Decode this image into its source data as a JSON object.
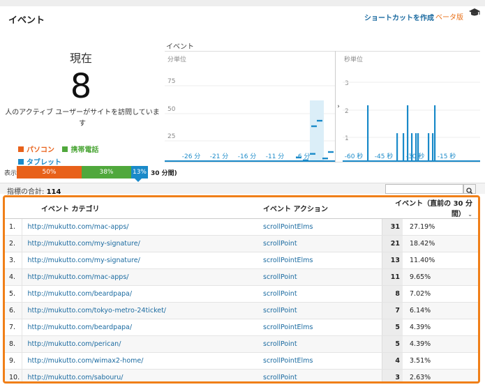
{
  "header": {
    "title": "イベント",
    "shortcut": "ショートカットを作成",
    "beta": "ベータ版"
  },
  "realtime": {
    "now_label": "現在",
    "active_users": "8",
    "description": "人のアクティブ ユーザーがサイトを訪問していま す"
  },
  "devices": {
    "prefix": "表示",
    "suffix": "30 分間)",
    "items": [
      {
        "name": "パソコン",
        "percent": "50%",
        "share": 50,
        "color": "#e8611a"
      },
      {
        "name": "携帯電話",
        "percent": "38%",
        "share": 38,
        "color": "#50a83c"
      },
      {
        "name": "タブレット",
        "percent": "13%",
        "share": 13,
        "color": "#1a8ac9"
      }
    ]
  },
  "charts": {
    "section_title": "イベント",
    "per_minute": {
      "label": "分単位",
      "y_ticks": [
        "75",
        "50",
        "25"
      ],
      "x_ticks": [
        "-26 分",
        "-21 分",
        "-16 分",
        "-11 分",
        "-6 分"
      ]
    },
    "per_second": {
      "label": "秒単位",
      "y_ticks": [
        "3",
        "2",
        "1"
      ],
      "x_ticks": [
        "-60 秒",
        "-45 秒",
        "-30 秒",
        "-15 秒"
      ]
    },
    "toggle": "›"
  },
  "chart_data": [
    {
      "type": "bar",
      "title": "分単位",
      "ylim": [
        0,
        100
      ],
      "x": [
        -7,
        -6,
        -5,
        -4,
        -3,
        -2,
        -1
      ],
      "values": [
        4,
        1,
        8,
        38,
        44,
        3,
        10
      ]
    },
    {
      "type": "bar",
      "title": "秒単位",
      "ylim": [
        0,
        4
      ],
      "x": [
        -49,
        -35,
        -32,
        -30,
        -28,
        -26,
        -25,
        -20,
        -18,
        -17
      ],
      "values": [
        2,
        1,
        1,
        2,
        1,
        1,
        1,
        1,
        1,
        2
      ]
    }
  ],
  "table": {
    "total_label": "指標の合計:",
    "total_value": "114",
    "columns": {
      "category": "イベント カテゴリ",
      "action": "イベント アクション",
      "events": "イベント（直前の 30 分間）"
    },
    "rows": [
      {
        "idx": "1.",
        "category": "http://mukutto.com/mac-apps/",
        "action": "scrollPointElms",
        "count": "31",
        "pct": "27.19%"
      },
      {
        "idx": "2.",
        "category": "http://mukutto.com/my-signature/",
        "action": "scrollPoint",
        "count": "21",
        "pct": "18.42%"
      },
      {
        "idx": "3.",
        "category": "http://mukutto.com/my-signature/",
        "action": "scrollPointElms",
        "count": "13",
        "pct": "11.40%"
      },
      {
        "idx": "4.",
        "category": "http://mukutto.com/mac-apps/",
        "action": "scrollPoint",
        "count": "11",
        "pct": "9.65%"
      },
      {
        "idx": "5.",
        "category": "http://mukutto.com/beardpapa/",
        "action": "scrollPoint",
        "count": "8",
        "pct": "7.02%"
      },
      {
        "idx": "6.",
        "category": "http://mukutto.com/tokyo-metro-24ticket/",
        "action": "scrollPoint",
        "count": "7",
        "pct": "6.14%"
      },
      {
        "idx": "7.",
        "category": "http://mukutto.com/beardpapa/",
        "action": "scrollPointElms",
        "count": "5",
        "pct": "4.39%"
      },
      {
        "idx": "8.",
        "category": "http://mukutto.com/perican/",
        "action": "scrollPoint",
        "count": "5",
        "pct": "4.39%"
      },
      {
        "idx": "9.",
        "category": "http://mukutto.com/wimax2-home/",
        "action": "scrollPointElms",
        "count": "4",
        "pct": "3.51%"
      },
      {
        "idx": "10.",
        "category": "http://mukutto.com/sabouru/",
        "action": "scrollPoint",
        "count": "3",
        "pct": "2.63%"
      }
    ]
  }
}
